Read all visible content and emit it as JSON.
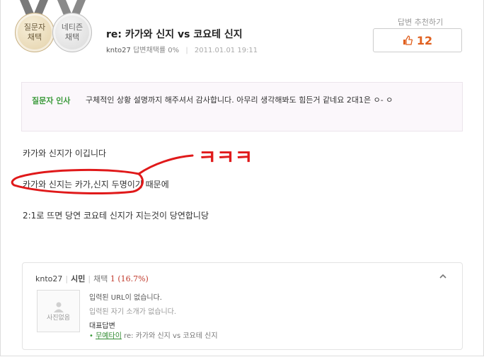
{
  "medals": {
    "asker": [
      "질문자",
      "채택"
    ],
    "netizen": [
      "네티즌",
      "채택"
    ]
  },
  "answer": {
    "title": "re: 카가와 신지 vs 코요테 신지",
    "author": "knto27",
    "adopt_rate_label": "답변채택률",
    "adopt_rate": "0%",
    "date": "2011.01.01 19:11"
  },
  "recommend": {
    "label": "답변 추천하기",
    "count": "12",
    "icon": "thumbs-up-icon",
    "color": "#e0601f"
  },
  "greeting": {
    "label": "질문자 인사",
    "text": "구체적인 상황 설명까지 해주셔서 감사합니다. 아무리 생각해봐도 힘든거 같네요 2대1은 ㅇ- ㅇ"
  },
  "body_lines": [
    "카가와 신지가 이깁니다",
    "카가와 신지는 카가,신지 두명이기 때문에",
    "2:1로 뜨면 당연 코요테 신지가 지는것이 당연합니당"
  ],
  "annotation": {
    "text": "ㅋㅋㅋ",
    "color": "#e0191a"
  },
  "profile": {
    "nickname": "knto27",
    "grade": "시민",
    "chosen_label": "채택",
    "chosen_count": "1 (16.7%)",
    "photo_placeholder": "사진없음",
    "url_text": "입력된 URL이 없습니다.",
    "intro_text": "입력된 자기 소개가 없습니다.",
    "rep_label": "대표답변",
    "rep_category": "무예타이",
    "rep_title": "re: 카가와 신지 vs 코요테 신지"
  }
}
